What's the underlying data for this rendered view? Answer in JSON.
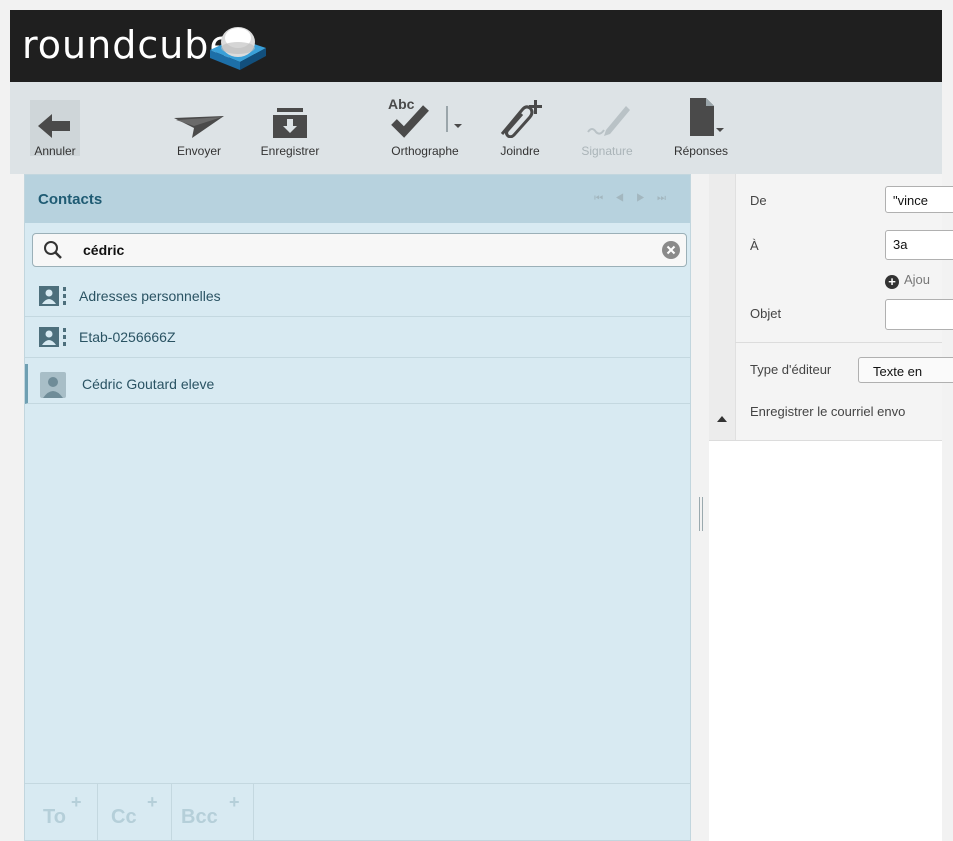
{
  "app": {
    "logo_text": "roundcube"
  },
  "toolbar": {
    "annuler": "Annuler",
    "envoyer": "Envoyer",
    "enregistrer": "Enregistrer",
    "orthographe": "Orthographe",
    "joindre": "Joindre",
    "signature": "Signature",
    "reponses": "Réponses"
  },
  "contacts": {
    "title": "Contacts",
    "search_value": "cédric",
    "items": [
      {
        "label": "Adresses personnelles",
        "icon": "addressbook-icon"
      },
      {
        "label": "Etab-0256666Z",
        "icon": "addressbook-icon"
      },
      {
        "label": "Cédric Goutard eleve",
        "icon": "contact-icon"
      }
    ],
    "footer": {
      "to": "To",
      "cc": "Cc",
      "bcc": "Bcc"
    }
  },
  "compose": {
    "from_label": "De",
    "from_value": "\"vince",
    "to_label": "À",
    "to_value": "3a",
    "add_header": "Ajou",
    "subject_label": "Objet",
    "subject_value": "",
    "editor_label": "Type d'éditeur",
    "editor_value": "Texte en",
    "save_sent_label": "Enregistrer le courriel envo"
  },
  "colors": {
    "topbar": "#1f1f1f",
    "toolbar": "#dde3e6",
    "panel": "#d8eaf2",
    "panel_header": "#b7d2de",
    "accent_text": "#1f5b73"
  }
}
